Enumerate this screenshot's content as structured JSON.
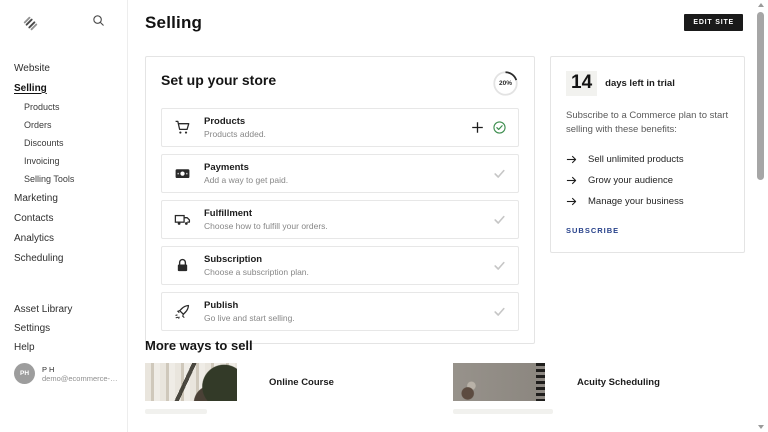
{
  "sidebar": {
    "logo_name": "squarespace-logo",
    "nav": [
      {
        "label": "Website",
        "level": 1,
        "active": false
      },
      {
        "label": "Selling",
        "level": 1,
        "active": true
      },
      {
        "label": "Products",
        "level": 2,
        "active": false
      },
      {
        "label": "Orders",
        "level": 2,
        "active": false
      },
      {
        "label": "Discounts",
        "level": 2,
        "active": false
      },
      {
        "label": "Invoicing",
        "level": 2,
        "active": false
      },
      {
        "label": "Selling Tools",
        "level": 2,
        "active": false
      },
      {
        "label": "Marketing",
        "level": 1,
        "active": false
      },
      {
        "label": "Contacts",
        "level": 1,
        "active": false
      },
      {
        "label": "Analytics",
        "level": 1,
        "active": false
      },
      {
        "label": "Scheduling",
        "level": 1,
        "active": false
      }
    ],
    "bottom_nav": [
      {
        "label": "Asset Library"
      },
      {
        "label": "Settings"
      },
      {
        "label": "Help"
      }
    ],
    "user": {
      "initials": "PH",
      "name": "P H",
      "email": "demo@ecommerce-go..."
    }
  },
  "header": {
    "title": "Selling",
    "edit_site_label": "EDIT SITE"
  },
  "setup": {
    "title": "Set up your store",
    "progress_label": "20%",
    "progress_percent": 20,
    "items": [
      {
        "title": "Products",
        "subtitle": "Products added.",
        "icon": "cart-icon",
        "status": "complete",
        "can_add": true
      },
      {
        "title": "Payments",
        "subtitle": "Add a way to get paid.",
        "icon": "cash-icon",
        "status": "pending",
        "can_add": false
      },
      {
        "title": "Fulfillment",
        "subtitle": "Choose how to fulfill your orders.",
        "icon": "truck-icon",
        "status": "pending",
        "can_add": false
      },
      {
        "title": "Subscription",
        "subtitle": "Choose a subscription plan.",
        "icon": "lock-icon",
        "status": "pending",
        "can_add": false
      },
      {
        "title": "Publish",
        "subtitle": "Go live and start selling.",
        "icon": "rocket-icon",
        "status": "pending",
        "can_add": false
      }
    ]
  },
  "trial": {
    "days": "14",
    "days_label": "days left in trial",
    "description": "Subscribe to a Commerce plan to start selling with these benefits:",
    "benefits": [
      "Sell unlimited products",
      "Grow your audience",
      "Manage your business"
    ],
    "cta_label": "SUBSCRIBE"
  },
  "more_ways": {
    "title": "More ways to sell",
    "cards": [
      {
        "title": "Online Course",
        "thumb": "course"
      },
      {
        "title": "Acuity Scheduling",
        "thumb": "acuity"
      }
    ]
  },
  "colors": {
    "complete_green": "#3e8e4f",
    "pending_gray": "#c6c6c6",
    "button_black": "#1a1a1a",
    "subscribe_blue": "#27418a"
  }
}
